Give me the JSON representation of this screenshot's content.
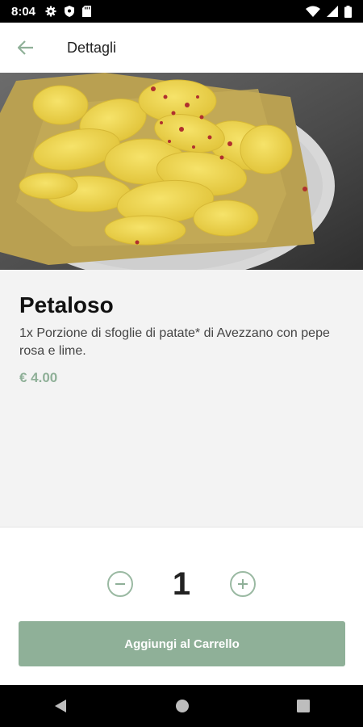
{
  "status_bar": {
    "time": "8:04"
  },
  "header": {
    "title": "Dettagli"
  },
  "product": {
    "name": "Petaloso",
    "description": "1x Porzione di sfoglie di patate* di Avezzano con pepe rosa e lime.",
    "price": "€ 4.00"
  },
  "quantity": {
    "value": "1",
    "minus_icon": "minus-circle-icon",
    "plus_icon": "plus-circle-icon"
  },
  "cart_button": {
    "label": "Aggiungi al Carrello"
  },
  "colors": {
    "accent": "#8fb098",
    "background": "#f3f3f3",
    "bars": "#000000"
  }
}
